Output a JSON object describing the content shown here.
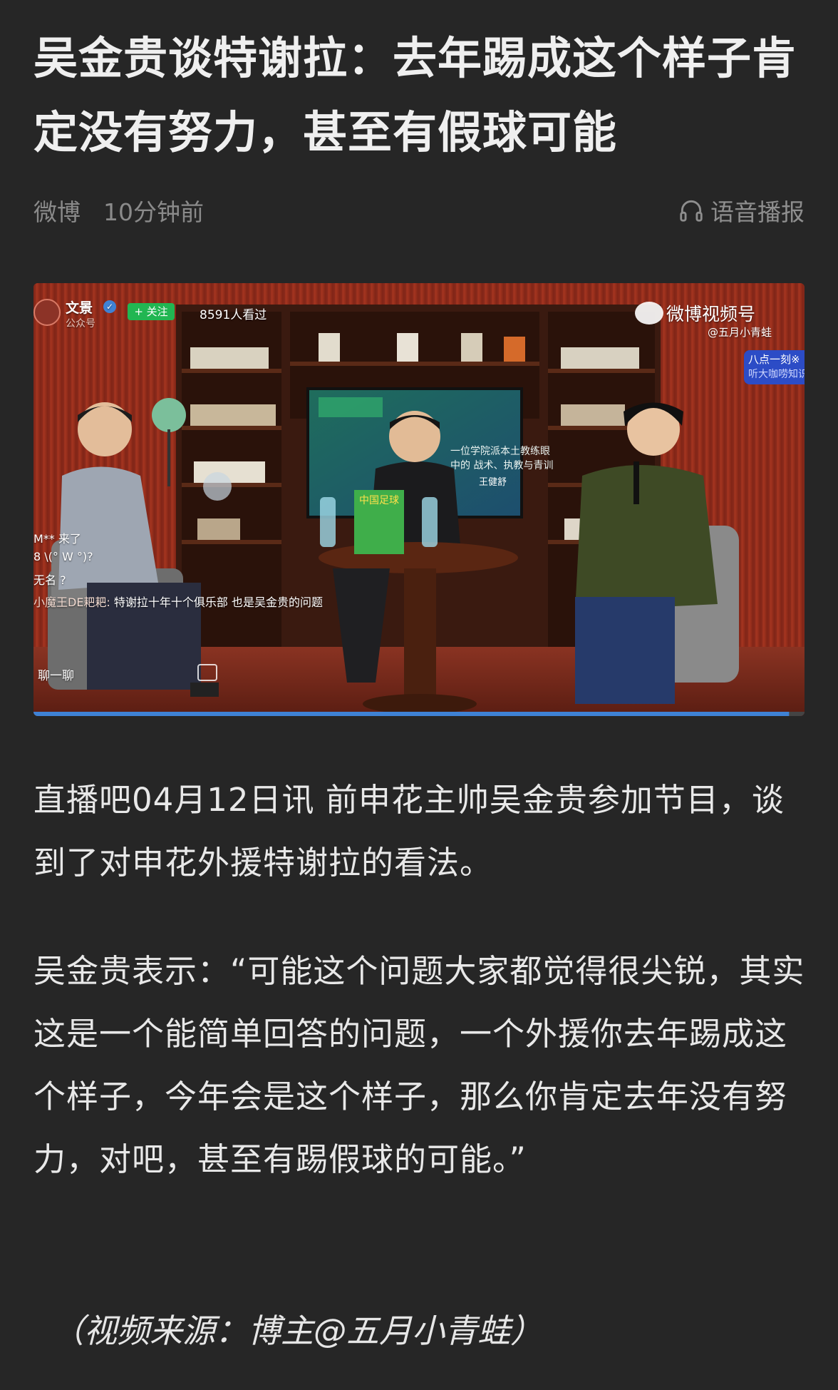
{
  "article": {
    "title": "吴金贵谈特谢拉：去年踢成这个样子肯定没有努力，甚至有假球可能",
    "source": "微博",
    "time": "10分钟前",
    "voice_label": "语音播报",
    "paragraph1": "直播吧04月12日讯 前申花主帅吴金贵参加节目，谈到了对申花外援特谢拉的看法。",
    "paragraph2": "吴金贵表示：“可能这个问题大家都觉得很尖锐，其实这是一个能简单回答的问题，一个外援你去年踢成这个样子，今年会是这个样子，那么你肯定去年没有努力，对吧，甚至有踢假球的可能。”",
    "caption": "（视频来源：博主@五月小青蛙）"
  },
  "video": {
    "account_name": "文景",
    "account_type": "公众号",
    "follow_label": "+ 关注",
    "viewers": "8591人看过",
    "platform": "微博视频号",
    "uploader": "@五月小青蛙",
    "promo_line1": "八点一刻※",
    "promo_line2": "听大咖唠知识",
    "comments": [
      {
        "user": "M**",
        "text": "来了"
      },
      {
        "user": "8",
        "text": "\\(°  W  °)?"
      },
      {
        "user": "无名",
        "text": "?"
      },
      {
        "user": "小魔王DE耙耙:",
        "text": "特谢拉十年十个俱乐部 也是吴金贵的问题"
      }
    ],
    "chat_label": "聊一聊",
    "screen_text": "一位学院派本土教练眼中的 战术、执教与青训",
    "screen_name": "王健舒",
    "book_title": "中国足球",
    "progress": 0.98
  },
  "colors": {
    "background": "#262626",
    "follow_green": "#21b652",
    "promo_blue": "#2c4cc6"
  }
}
